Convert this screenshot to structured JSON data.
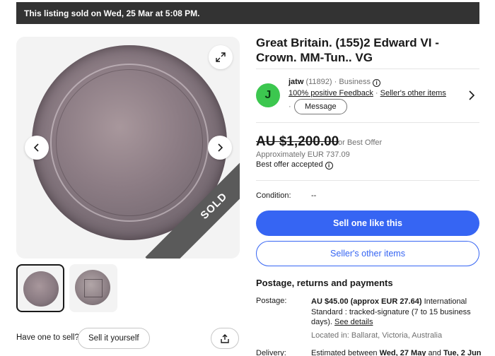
{
  "banner": {
    "text": "This listing sold on Wed, 25 Mar at 5:08 PM."
  },
  "gallery": {
    "sold_label": "SOLD"
  },
  "listing": {
    "title": "Great Britain. (155)2 Edward VI - Crown. MM-Tun.. VG"
  },
  "seller": {
    "avatar_letter": "J",
    "name": "jatw",
    "feedback_count": "(11892)",
    "type": "· Business",
    "positive_feedback": "100% positive Feedback",
    "separator": "·",
    "other_items": "Seller's other items",
    "dot": "·",
    "message_label": "Message"
  },
  "price": {
    "amount": "AU $1,200.00",
    "or_best_offer": "or Best Offer",
    "approx_prefix": "Approximately",
    "approx_value": "EUR 737.09",
    "offer_accepted": "Best offer accepted"
  },
  "condition": {
    "label": "Condition:",
    "value": "--"
  },
  "actions": {
    "sell_one": "Sell one like this",
    "seller_other_items": "Seller's other items"
  },
  "sell_yours": {
    "prompt": "Have one to sell?",
    "button": "Sell it yourself"
  },
  "shipping": {
    "section_title": "Postage, returns and payments",
    "postage_label": "Postage:",
    "postage_amount": "AU $45.00 (approx EUR 27.64)",
    "postage_service": "International Standard : tracked-signature (7 to 15 business days).",
    "see_details": "See details",
    "located": "Located in: Ballarat, Victoria, Australia",
    "delivery_label": "Delivery:",
    "delivery_prefix": "Estimated between",
    "delivery_start": "Wed, 27 May",
    "delivery_and": "and",
    "delivery_end": "Tue, 2 Jun"
  },
  "colors": {
    "primary": "#3665f3",
    "banner_bg": "#333333",
    "avatar": "#3cc74f"
  }
}
